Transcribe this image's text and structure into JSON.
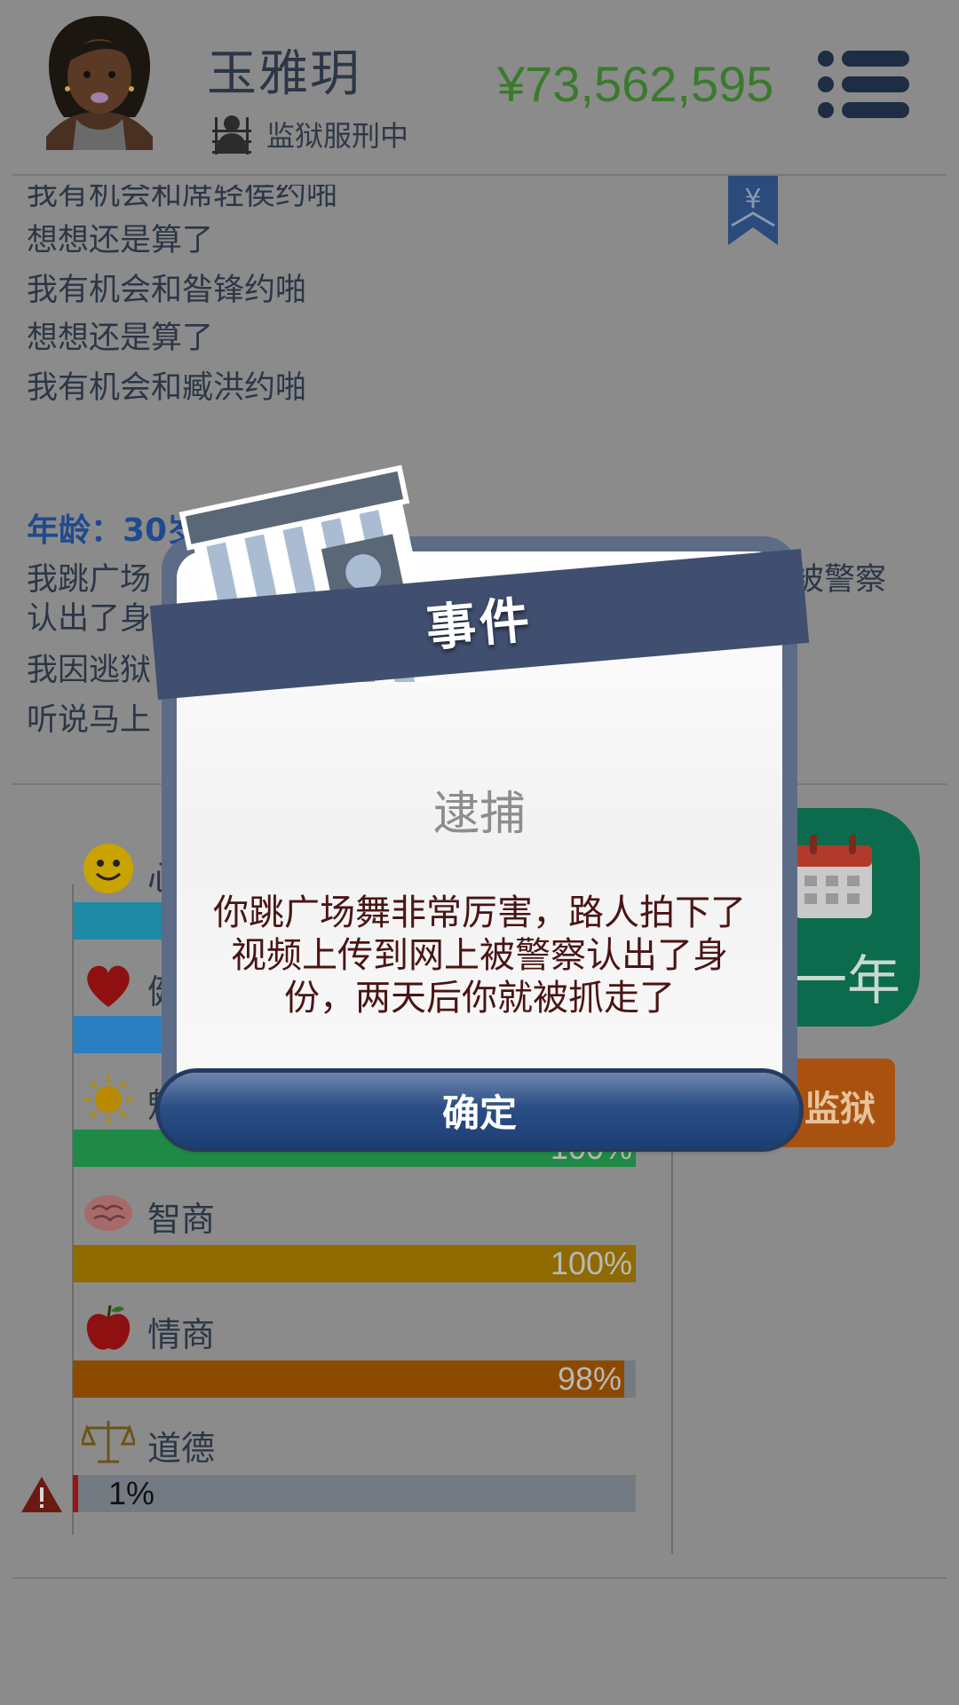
{
  "header": {
    "name": "玉雅玥",
    "status": "监狱服刑中",
    "money": "¥73,562,595"
  },
  "log": {
    "lines": [
      "我有机会和席轻侯约啪",
      "想想还是算了",
      "我有机会和昝锋约啪",
      "想想还是算了",
      "我有机会和臧洪约啪"
    ],
    "age": "年龄：30岁",
    "entries": [
      "我跳广场",
      "认出了身",
      "我因逃狱",
      "听说马上"
    ],
    "entry_tail": "上被警察"
  },
  "stats": {
    "mood_label": "心",
    "health_label": "健",
    "charm_label": "魅",
    "charm_value": "100%",
    "iq_label": "智商",
    "iq_value": "100%",
    "eq_label": "情商",
    "eq_value": "98%",
    "moral_label": "道德",
    "moral_value": "1%",
    "fractions": {
      "mood": 1.0,
      "health": 1.0,
      "charm": 1.0,
      "iq": 1.0,
      "eq": 0.98,
      "moral": 0.01
    }
  },
  "side": {
    "next_year_label": "一年",
    "prison_label": "监狱"
  },
  "modal": {
    "ribbon": "事件",
    "title": "逮捕",
    "message": "你跳广场舞非常厉害，路人拍下了视频上传到网上被警察认出了身份，两天后你就被抓走了",
    "confirm": "确定"
  },
  "colors": {
    "mood": "#1e8aa6",
    "health": "#2a7fc0",
    "charm": "#1f8a45",
    "iq": "#8e6a00",
    "eq": "#8c4a00",
    "moral": "#9a1515",
    "money": "#3a7a2c",
    "ribbon": "#404f70"
  },
  "icons": {
    "avatar": "woman-avatar-icon",
    "status": "prisoner-icon",
    "menu": "menu-icon",
    "bookmark": "yen-bookmark-icon",
    "mood": "smiley-icon",
    "health": "heart-icon",
    "charm": "sun-icon",
    "iq": "brain-icon",
    "eq": "apple-icon",
    "moral": "scales-icon",
    "warning": "warning-icon",
    "calendar": "calendar-icon",
    "prison": "prison-building-icon"
  }
}
